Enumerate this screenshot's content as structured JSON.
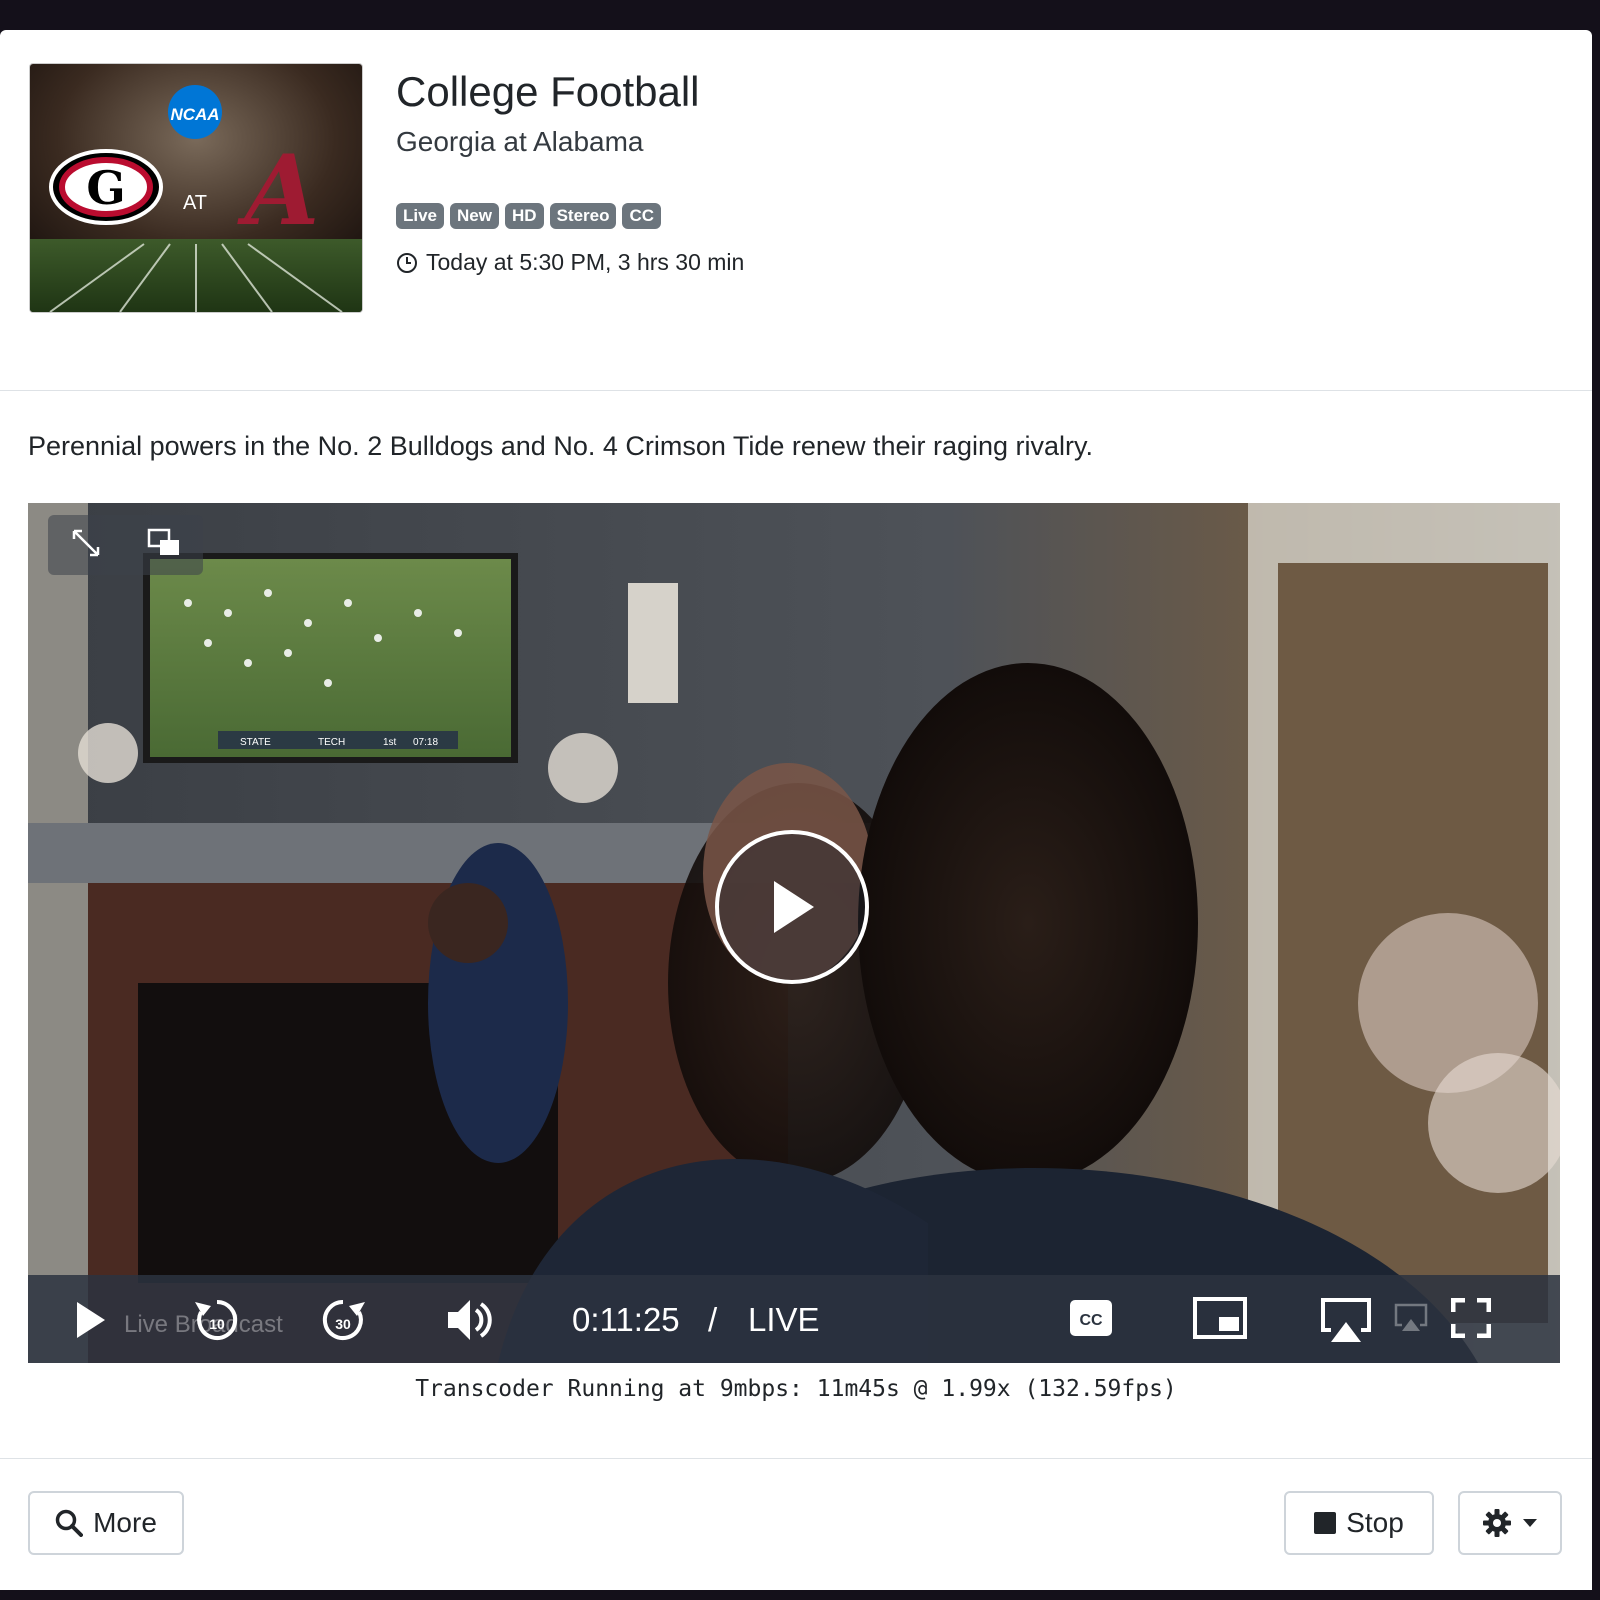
{
  "program": {
    "title": "College Football",
    "subtitle": "Georgia at Alabama",
    "badges": [
      "Live",
      "New",
      "HD",
      "Stereo",
      "CC"
    ],
    "airtime": "Today at 5:30 PM, 3 hrs 30 min",
    "description": "Perennial powers in the No. 2 Bulldogs and No. 4 Crimson Tide renew their raging rivalry."
  },
  "thumbnail": {
    "ncaa_text": "NCAA",
    "at_text": "AT",
    "home_letter": "A",
    "away_letter": "G"
  },
  "player": {
    "time": "0:11:25",
    "separator": "/",
    "live_label": "LIVE",
    "live_broadcast_label": "Live Broadcast",
    "rewind_seconds": "10",
    "forward_seconds": "30",
    "tv_scoreboard": [
      "STATE",
      "TECH",
      "1st",
      "07:18"
    ]
  },
  "status": {
    "transcoder": "Transcoder Running at 9mbps: 11m45s @ 1.99x (132.59fps)"
  },
  "footer": {
    "more_label": "More",
    "stop_label": "Stop"
  },
  "icons": {
    "more": "search-icon",
    "stop": "stop-square-icon",
    "settings": "gear-icon",
    "clock": "clock-icon"
  },
  "colors": {
    "badge": "#6c757d",
    "georgia_red": "#ba0c2f",
    "alabama_crimson": "#9e1b32",
    "ncaa_blue": "#0076d6"
  }
}
